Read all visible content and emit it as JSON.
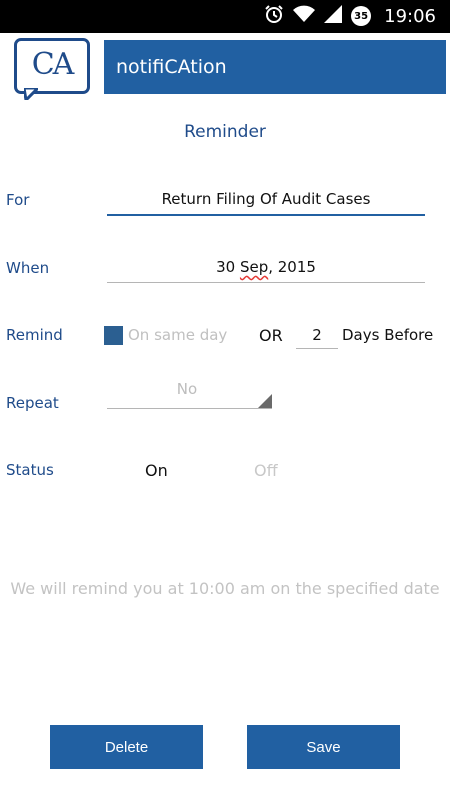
{
  "status_bar": {
    "time": "19:06",
    "battery_level": "35",
    "icons": [
      "alarm-icon",
      "wifi-icon",
      "signal-icon",
      "battery-icon"
    ]
  },
  "header": {
    "logo_text": "CA",
    "title": "notifiCAtion"
  },
  "page": {
    "heading": "Reminder"
  },
  "form": {
    "for": {
      "label": "For",
      "value": "Return Filing Of Audit Cases"
    },
    "when": {
      "label": "When",
      "day": "30",
      "month": "Sep",
      "year_part": ", 2015"
    },
    "remind": {
      "label": "Remind",
      "same_day_label": "On same day",
      "same_day_checked": true,
      "or_label": "OR",
      "days_value": "2",
      "days_suffix": "Days Before"
    },
    "repeat": {
      "label": "Repeat",
      "selected": "No"
    },
    "status": {
      "label": "Status",
      "on_label": "On",
      "off_label": "Off",
      "active": "On"
    }
  },
  "note": "We will remind you at 10:00 am on the specified date",
  "buttons": {
    "delete": "Delete",
    "save": "Save"
  },
  "colors": {
    "primary": "#2160a2",
    "label": "#1f4b8a",
    "muted": "#c0c0c0"
  }
}
